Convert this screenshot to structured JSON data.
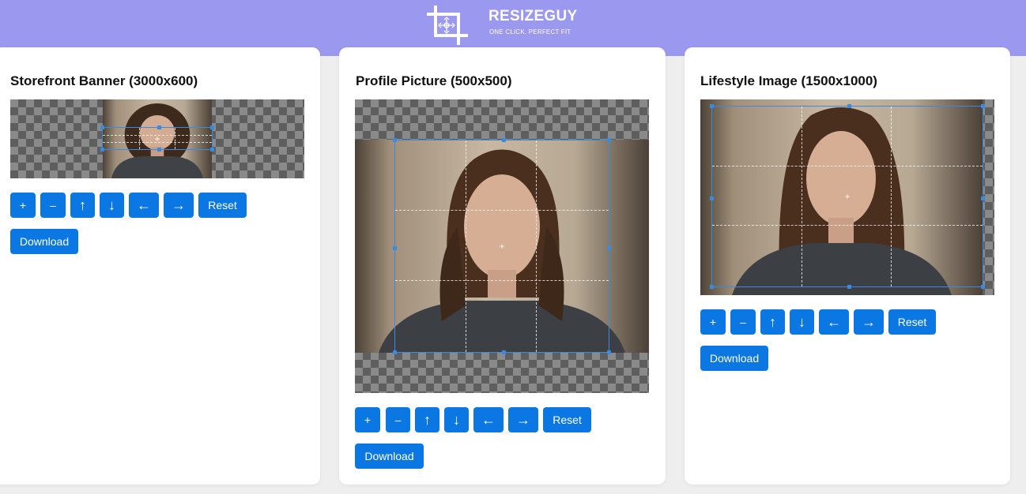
{
  "header": {
    "brand": "RESIZEGUY",
    "tagline": "ONE CLICK. PERFECT FIT",
    "logo_icon": "crop-icon",
    "background": "#9b98ef"
  },
  "controls": {
    "zoom_in": "+",
    "zoom_out": "–",
    "move_up": "↑",
    "move_down": "↓",
    "move_left": "←",
    "move_right": "→",
    "reset": "Reset",
    "download": "Download"
  },
  "cards": [
    {
      "title": "Storefront Banner (3000x600)"
    },
    {
      "title": "Profile Picture (500x500)"
    },
    {
      "title": "Lifestyle Image (1500x1000)"
    }
  ],
  "colors": {
    "accent": "#0a77e3",
    "crop_border": "#3a8be0",
    "page_bg": "#eeeeee"
  }
}
